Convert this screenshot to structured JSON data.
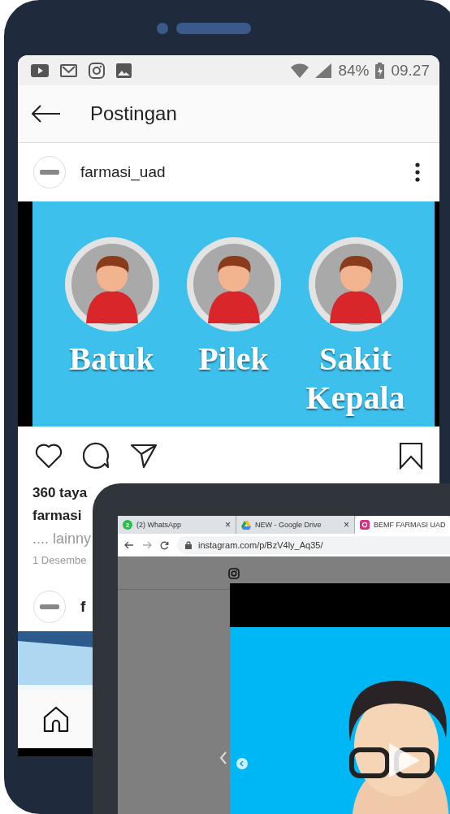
{
  "phone": {
    "status_bar": {
      "battery": "84%",
      "time": "09.27"
    },
    "header": {
      "title": "Postingan"
    },
    "post": {
      "username": "farmasi_uad",
      "image_words": [
        "Batuk",
        "Pilek",
        "Sakit Kepala"
      ],
      "views": "360 taya",
      "caption_user": "farmasi",
      "more": ".... lainny",
      "date": "1 Desembe"
    },
    "next_post": {
      "username": "f"
    }
  },
  "laptop": {
    "tabs": [
      {
        "kind": "chat",
        "badge": "2",
        "title": "(2) WhatsApp",
        "close": "×",
        "selected": false
      },
      {
        "kind": "drive",
        "title": "NEW - Google Drive",
        "close": "×",
        "selected": false
      },
      {
        "kind": "camera",
        "title": "BEMF FARMASI UAD",
        "selected": true
      }
    ],
    "url": "instagram.com/p/BzV4ly_Aq35/"
  }
}
